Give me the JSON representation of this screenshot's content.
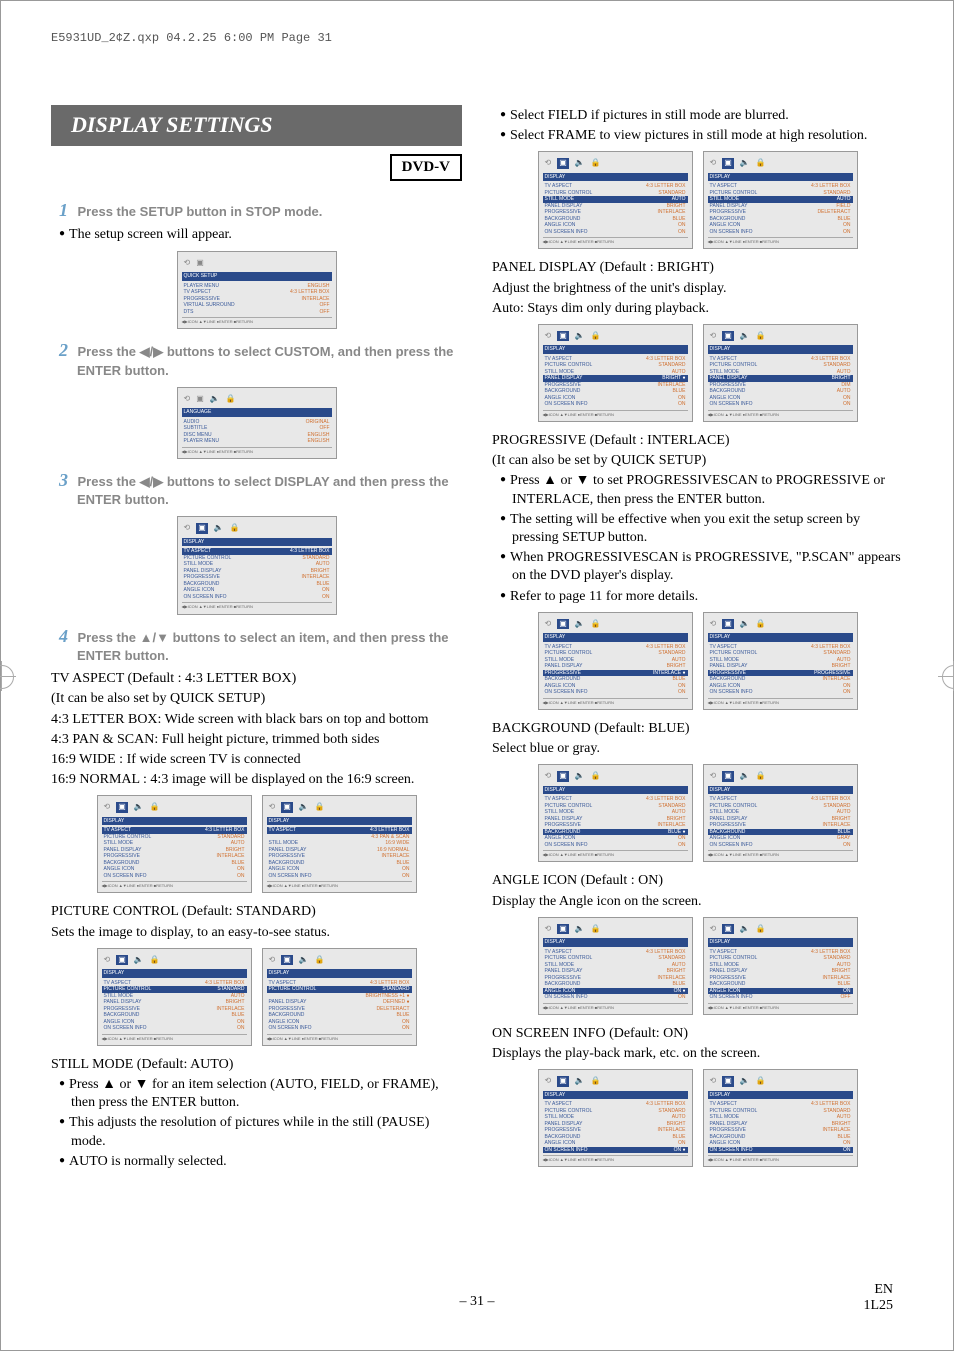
{
  "header": "E5931UD_2¢Z.qxp  04.2.25  6:00 PM  Page 31",
  "title": "DISPLAY SETTINGS",
  "dvd_label": "DVD-V",
  "steps": {
    "s1_num": "1",
    "s1_text": "Press the SETUP button in STOP mode.",
    "s1_bullet": "The setup screen will appear.",
    "s2_num": "2",
    "s2_text": "Press the ◀/▶ buttons to select CUSTOM, and then press the ENTER button.",
    "s3_num": "3",
    "s3_text": "Press the ◀/▶ buttons to select DISPLAY and then press the ENTER button.",
    "s4_num": "4",
    "s4_text": "Press the ▲/▼ buttons to select an item, and then press the ENTER button."
  },
  "tv_aspect": {
    "head": "TV ASPECT (Default : 4:3 LETTER BOX)",
    "sub": "(It can be also set by QUICK SETUP)",
    "l1": "4:3 LETTER BOX: Wide screen with black bars on top and bottom",
    "l2": "4:3 PAN & SCAN: Full height picture, trimmed both sides",
    "l3": "16:9 WIDE : If wide screen TV is connected",
    "l4": "16:9 NORMAL : 4:3 image will be displayed on the 16:9 screen."
  },
  "pic_ctrl": {
    "head": "PICTURE CONTROL (Default: STANDARD)",
    "sub": "Sets the image to display, to an easy-to-see status."
  },
  "still": {
    "head": "STILL MODE (Default: AUTO)",
    "b1": "Press ▲ or ▼ for an item selection (AUTO, FIELD, or FRAME), then press the ENTER button.",
    "b2": "This adjusts the resolution of pictures while in the still (PAUSE) mode.",
    "b3": "AUTO is normally selected."
  },
  "right": {
    "r1": "Select FIELD if pictures in still mode are blurred.",
    "r2": "Select FRAME to view pictures in still mode at high resolution."
  },
  "panel": {
    "head": "PANEL DISPLAY (Default : BRIGHT)",
    "l1": "Adjust the brightness of the unit's display.",
    "l2": "Auto: Stays dim only during playback."
  },
  "prog": {
    "head": "PROGRESSIVE (Default : INTERLACE)",
    "sub": "(It can also be set by QUICK SETUP)",
    "b1": "Press ▲ or ▼ to set PROGRESSIVESCAN to PROGRESSIVE or INTERLACE, then press the ENTER button.",
    "b2": "The setting will be effective when you exit the setup screen by pressing SETUP button.",
    "b3": "When PROGRESSIVESCAN is PROGRESSIVE, \"P.SCAN\" appears on the DVD player's display.",
    "b4": "Refer to page 11 for more details."
  },
  "bg": {
    "head": "BACKGROUND (Default: BLUE)",
    "sub": "Select blue or gray."
  },
  "angle": {
    "head": "ANGLE ICON (Default : ON)",
    "sub": "Display the Angle icon on the screen."
  },
  "osi": {
    "head": "ON SCREEN INFO (Default: ON)",
    "sub": "Displays the play-back mark, etc. on the screen."
  },
  "screens": {
    "quick": {
      "header": "QUICK SETUP",
      "rows": [
        {
          "k": "PLAYER MENU",
          "v": "ENGLISH"
        },
        {
          "k": "TV ASPECT",
          "v": "4:3 LETTER BOX"
        },
        {
          "k": "PROGRESSIVE",
          "v": "INTERLACE"
        },
        {
          "k": "VIRTUAL SURROUND",
          "v": "OFF"
        },
        {
          "k": "DTS",
          "v": "OFF"
        }
      ]
    },
    "language": {
      "header": "LANGUAGE",
      "rows": [
        {
          "k": "AUDIO",
          "v": "ORIGINAL"
        },
        {
          "k": "SUBTITLE",
          "v": "OFF"
        },
        {
          "k": "DISC MENU",
          "v": "ENGLISH"
        },
        {
          "k": "PLAYER MENU",
          "v": "ENGLISH"
        }
      ]
    },
    "display_base": {
      "header": "DISPLAY",
      "rows": [
        {
          "k": "TV ASPECT",
          "v": "4:3 LETTER BOX"
        },
        {
          "k": "PICTURE CONTROL",
          "v": "STANDARD"
        },
        {
          "k": "STILL MODE",
          "v": "AUTO"
        },
        {
          "k": "PANEL DISPLAY",
          "v": "BRIGHT"
        },
        {
          "k": "PROGRESSIVE",
          "v": "INTERLACE"
        },
        {
          "k": "BACKGROUND",
          "v": "BLUE"
        },
        {
          "k": "ANGLE ICON",
          "v": "ON"
        },
        {
          "k": "ON SCREEN INFO",
          "v": "ON"
        }
      ]
    },
    "foot": "◀▶ICON  ▲▼LINE  ●ENTER  ■RETURN"
  },
  "footer": {
    "page": "– 31 –",
    "lang": "EN",
    "code": "1L25"
  }
}
